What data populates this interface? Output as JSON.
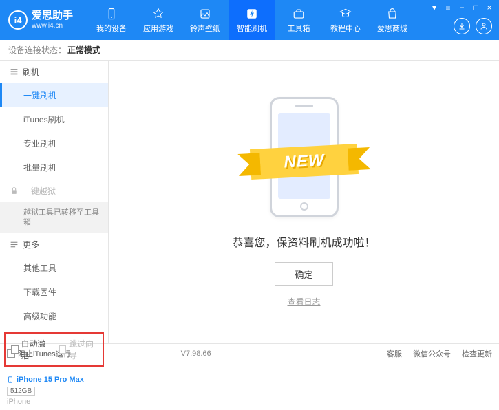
{
  "header": {
    "logo_letter": "i4",
    "logo_title": "爱思助手",
    "logo_sub": "www.i4.cn",
    "nav": [
      {
        "label": "我的设备"
      },
      {
        "label": "应用游戏"
      },
      {
        "label": "铃声壁纸"
      },
      {
        "label": "智能刷机"
      },
      {
        "label": "工具箱"
      },
      {
        "label": "教程中心"
      },
      {
        "label": "爱思商城"
      }
    ]
  },
  "status": {
    "label": "设备连接状态：",
    "value": "正常模式"
  },
  "sidebar": {
    "group1": "刷机",
    "items1": [
      "一键刷机",
      "iTunes刷机",
      "专业刷机",
      "批量刷机"
    ],
    "group2": "一键越狱",
    "note": "越狱工具已转移至工具箱",
    "group3": "更多",
    "items3": [
      "其他工具",
      "下载固件",
      "高级功能"
    ],
    "checkbox1": "自动激活",
    "checkbox2": "跳过向导",
    "device": {
      "name": "iPhone 15 Pro Max",
      "storage": "512GB",
      "type": "iPhone"
    }
  },
  "main": {
    "ribbon": "NEW",
    "success": "恭喜您，保资料刷机成功啦！",
    "ok": "确定",
    "log": "查看日志"
  },
  "footer": {
    "block_itunes": "阻止iTunes运行",
    "version": "V7.98.66",
    "links": [
      "客服",
      "微信公众号",
      "检查更新"
    ]
  }
}
